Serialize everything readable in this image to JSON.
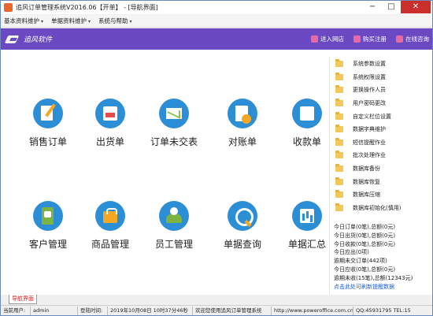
{
  "window": {
    "title": "追风订单管理系统V2016.06【开单】 - [导航界面]",
    "controls": {
      "minimize": "−",
      "maximize": "□",
      "close": "✕"
    }
  },
  "menubar": {
    "items": [
      {
        "label": "基本资料维护"
      },
      {
        "label": "单据资料维护"
      },
      {
        "label": "系统与帮助"
      }
    ]
  },
  "header": {
    "brand": "追风软件",
    "links": [
      {
        "label": "进入网店",
        "icon": "shop-icon"
      },
      {
        "label": "购买注册",
        "icon": "cart-icon"
      },
      {
        "label": "在线咨询",
        "icon": "chat-icon"
      }
    ]
  },
  "tiles": [
    {
      "label": "销售订单",
      "icon": "sales-order-icon"
    },
    {
      "label": "出货单",
      "icon": "shipment-icon"
    },
    {
      "label": "订单未交表",
      "icon": "undelivered-report-icon"
    },
    {
      "label": "对账单",
      "icon": "statement-icon"
    },
    {
      "label": "收款单",
      "icon": "receipt-icon"
    },
    {
      "label": "客户管理",
      "icon": "customer-icon"
    },
    {
      "label": "商品管理",
      "icon": "product-icon"
    },
    {
      "label": "员工管理",
      "icon": "staff-icon"
    },
    {
      "label": "单据查询",
      "icon": "document-query-icon"
    },
    {
      "label": "单据汇总",
      "icon": "document-summary-icon"
    }
  ],
  "side_menu": {
    "items": [
      {
        "label": "系统参数设置"
      },
      {
        "label": "系统权限设置"
      },
      {
        "label": "更换操作人员"
      },
      {
        "label": "用户密码更改"
      },
      {
        "label": "自定义栏位设置"
      },
      {
        "label": "数据字典维护"
      },
      {
        "label": "短信提醒作业"
      },
      {
        "label": "批次处理作业"
      },
      {
        "label": "数据库备份"
      },
      {
        "label": "数据库恢复"
      },
      {
        "label": "数据库压缩"
      },
      {
        "label": "数据库初始化(慎用)"
      }
    ]
  },
  "stats": {
    "lines": [
      "今日订单(0笔),总额(0元)",
      "今日出货(0笔),总额(0元)",
      "今日收款(0笔),总额(0元)",
      "今日应出(0项)",
      "逾期未交订单(442项)",
      "今日应收(0笔),总额(0元)",
      "逾期未收(15笔),总额(12343元)"
    ],
    "refresh_link": "点击此处可刷新提醒数据"
  },
  "tab": {
    "label": "导航界面"
  },
  "statusbar": {
    "user_label": "当前用户:",
    "user_value": "admin",
    "login_label": "登陆时间:",
    "login_value": "2019年10月08日 10时37分46秒",
    "welcome": "欢迎您使用追风订单管理系统",
    "website": "http://www.poweroffice.com.cn",
    "contact": "QQ:45931795 TEL:15"
  }
}
